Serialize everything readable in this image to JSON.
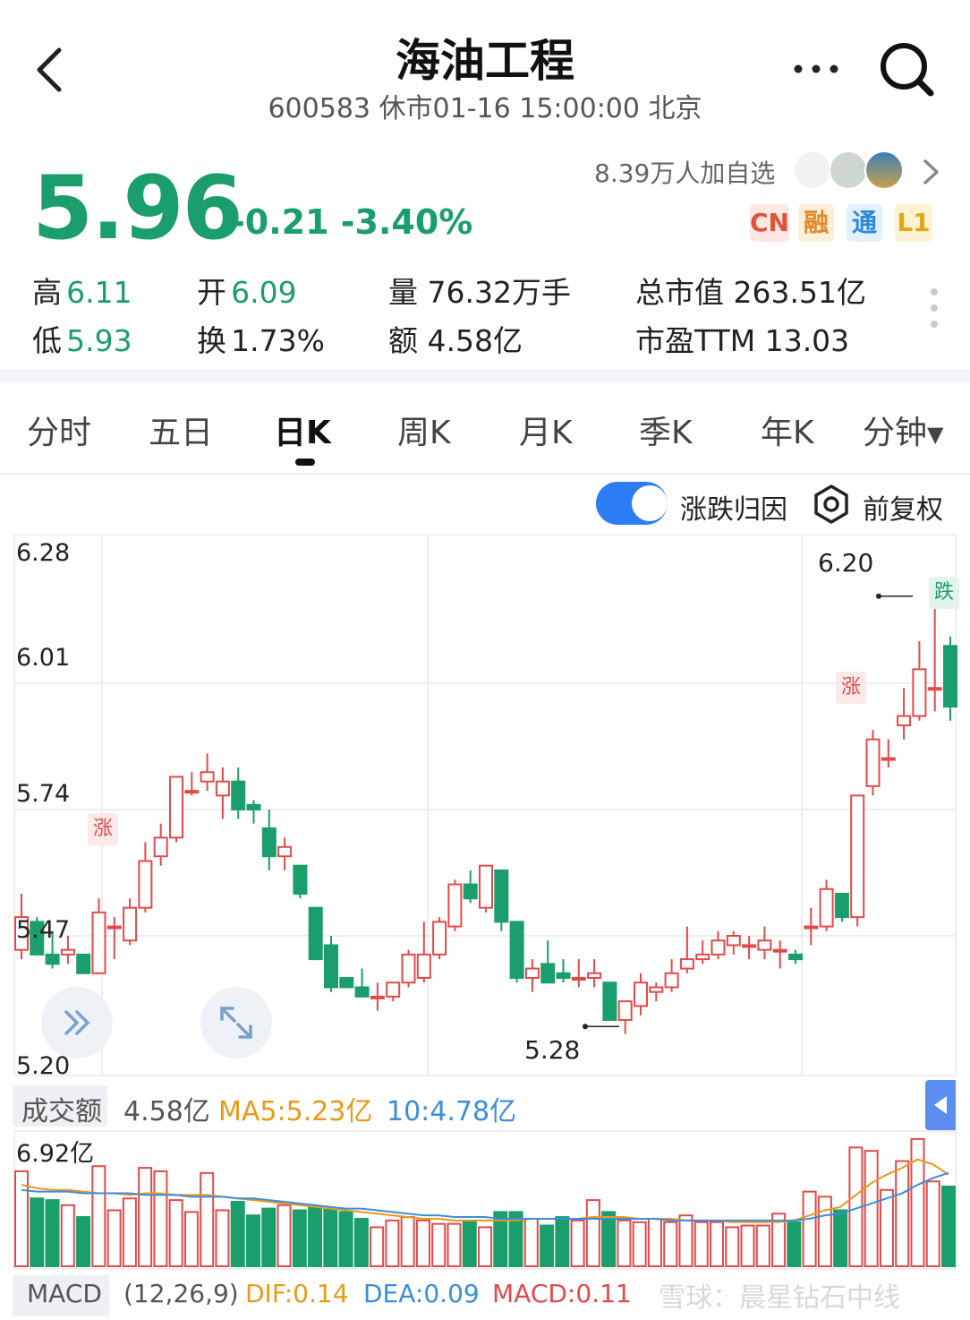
{
  "header": {
    "title": "海油工程",
    "subtitle": "600583 休市01-16 15:00:00 北京"
  },
  "quote": {
    "price": "5.96",
    "change": "-0.21 -3.40%",
    "followers": "8.39万人加自选",
    "badges": [
      "CN",
      "融",
      "通",
      "L1"
    ],
    "stats": {
      "high_label": "高",
      "high": "6.11",
      "low_label": "低",
      "low": "5.93",
      "open_label": "开",
      "open": "6.09",
      "turnover_label": "换",
      "turnover": "1.73%",
      "volume": "量 76.32万手",
      "amount": "额 4.58亿",
      "market_cap": "总市值 263.51亿",
      "pe": "市盈TTM 13.03"
    }
  },
  "tabs": [
    "分时",
    "五日",
    "日K",
    "周K",
    "月K",
    "季K",
    "年K",
    "分钟"
  ],
  "active_tab": "日K",
  "controls": {
    "toggle_label": "涨跌归因",
    "adjust_label": "前复权"
  },
  "chart_data": {
    "type": "candlestick",
    "y_ticks": [
      "6.28",
      "6.01",
      "5.74",
      "5.47",
      "5.20"
    ],
    "ylim": [
      5.2,
      6.28
    ],
    "annotations": {
      "max": "6.20",
      "min": "5.28",
      "rise_tag": "涨",
      "fall_tag": "跌"
    },
    "candles": [
      {
        "o": 5.44,
        "h": 5.56,
        "l": 5.42,
        "c": 5.51
      },
      {
        "o": 5.5,
        "h": 5.51,
        "l": 5.43,
        "c": 5.43
      },
      {
        "o": 5.43,
        "h": 5.48,
        "l": 5.4,
        "c": 5.41
      },
      {
        "o": 5.43,
        "h": 5.47,
        "l": 5.41,
        "c": 5.44
      },
      {
        "o": 5.43,
        "h": 5.43,
        "l": 5.39,
        "c": 5.39
      },
      {
        "o": 5.39,
        "h": 5.55,
        "l": 5.39,
        "c": 5.52
      },
      {
        "o": 5.49,
        "h": 5.51,
        "l": 5.42,
        "c": 5.49
      },
      {
        "o": 5.46,
        "h": 5.55,
        "l": 5.45,
        "c": 5.53
      },
      {
        "o": 5.53,
        "h": 5.67,
        "l": 5.52,
        "c": 5.63
      },
      {
        "o": 5.64,
        "h": 5.71,
        "l": 5.62,
        "c": 5.68
      },
      {
        "o": 5.68,
        "h": 5.81,
        "l": 5.67,
        "c": 5.81
      },
      {
        "o": 5.78,
        "h": 5.82,
        "l": 5.77,
        "c": 5.78
      },
      {
        "o": 5.8,
        "h": 5.86,
        "l": 5.78,
        "c": 5.82
      },
      {
        "o": 5.77,
        "h": 5.83,
        "l": 5.72,
        "c": 5.8
      },
      {
        "o": 5.8,
        "h": 5.83,
        "l": 5.72,
        "c": 5.74
      },
      {
        "o": 5.75,
        "h": 5.76,
        "l": 5.71,
        "c": 5.74
      },
      {
        "o": 5.7,
        "h": 5.74,
        "l": 5.61,
        "c": 5.64
      },
      {
        "o": 5.64,
        "h": 5.68,
        "l": 5.61,
        "c": 5.66
      },
      {
        "o": 5.62,
        "h": 5.62,
        "l": 5.55,
        "c": 5.56
      },
      {
        "o": 5.53,
        "h": 5.53,
        "l": 5.42,
        "c": 5.42
      },
      {
        "o": 5.45,
        "h": 5.47,
        "l": 5.35,
        "c": 5.36
      },
      {
        "o": 5.38,
        "h": 5.38,
        "l": 5.36,
        "c": 5.36
      },
      {
        "o": 5.36,
        "h": 5.4,
        "l": 5.34,
        "c": 5.34
      },
      {
        "o": 5.34,
        "h": 5.37,
        "l": 5.31,
        "c": 5.34
      },
      {
        "o": 5.34,
        "h": 5.37,
        "l": 5.33,
        "c": 5.37
      },
      {
        "o": 5.37,
        "h": 5.44,
        "l": 5.36,
        "c": 5.43
      },
      {
        "o": 5.38,
        "h": 5.5,
        "l": 5.37,
        "c": 5.43
      },
      {
        "o": 5.43,
        "h": 5.51,
        "l": 5.42,
        "c": 5.5
      },
      {
        "o": 5.49,
        "h": 5.59,
        "l": 5.48,
        "c": 5.58
      },
      {
        "o": 5.58,
        "h": 5.61,
        "l": 5.54,
        "c": 5.55
      },
      {
        "o": 5.53,
        "h": 5.62,
        "l": 5.52,
        "c": 5.62
      },
      {
        "o": 5.61,
        "h": 5.61,
        "l": 5.48,
        "c": 5.5
      },
      {
        "o": 5.5,
        "h": 5.5,
        "l": 5.37,
        "c": 5.38
      },
      {
        "o": 5.38,
        "h": 5.42,
        "l": 5.35,
        "c": 5.4
      },
      {
        "o": 5.41,
        "h": 5.46,
        "l": 5.37,
        "c": 5.37
      },
      {
        "o": 5.39,
        "h": 5.42,
        "l": 5.37,
        "c": 5.38
      },
      {
        "o": 5.38,
        "h": 5.42,
        "l": 5.36,
        "c": 5.38
      },
      {
        "o": 5.38,
        "h": 5.42,
        "l": 5.36,
        "c": 5.39
      },
      {
        "o": 5.37,
        "h": 5.37,
        "l": 5.29,
        "c": 5.29
      },
      {
        "o": 5.29,
        "h": 5.33,
        "l": 5.26,
        "c": 5.33
      },
      {
        "o": 5.32,
        "h": 5.39,
        "l": 5.3,
        "c": 5.37
      },
      {
        "o": 5.35,
        "h": 5.37,
        "l": 5.33,
        "c": 5.36
      },
      {
        "o": 5.36,
        "h": 5.42,
        "l": 5.35,
        "c": 5.39
      },
      {
        "o": 5.4,
        "h": 5.49,
        "l": 5.39,
        "c": 5.42
      },
      {
        "o": 5.42,
        "h": 5.46,
        "l": 5.41,
        "c": 5.43
      },
      {
        "o": 5.43,
        "h": 5.48,
        "l": 5.42,
        "c": 5.46
      },
      {
        "o": 5.45,
        "h": 5.48,
        "l": 5.43,
        "c": 5.47
      },
      {
        "o": 5.45,
        "h": 5.47,
        "l": 5.42,
        "c": 5.45
      },
      {
        "o": 5.44,
        "h": 5.49,
        "l": 5.42,
        "c": 5.46
      },
      {
        "o": 5.44,
        "h": 5.46,
        "l": 5.4,
        "c": 5.44
      },
      {
        "o": 5.43,
        "h": 5.44,
        "l": 5.41,
        "c": 5.42
      },
      {
        "o": 5.49,
        "h": 5.53,
        "l": 5.45,
        "c": 5.49
      },
      {
        "o": 5.49,
        "h": 5.59,
        "l": 5.48,
        "c": 5.57
      },
      {
        "o": 5.56,
        "h": 5.56,
        "l": 5.5,
        "c": 5.51
      },
      {
        "o": 5.51,
        "h": 5.77,
        "l": 5.49,
        "c": 5.77
      },
      {
        "o": 5.79,
        "h": 5.91,
        "l": 5.77,
        "c": 5.89
      },
      {
        "o": 5.85,
        "h": 5.89,
        "l": 5.83,
        "c": 5.85
      },
      {
        "o": 5.92,
        "h": 6.0,
        "l": 5.89,
        "c": 5.94
      },
      {
        "o": 5.94,
        "h": 6.1,
        "l": 5.93,
        "c": 6.04
      },
      {
        "o": 6.0,
        "h": 6.17,
        "l": 5.95,
        "c": 6.0
      },
      {
        "o": 6.09,
        "h": 6.11,
        "l": 5.93,
        "c": 5.96
      }
    ]
  },
  "volume": {
    "label": "成交额",
    "value": "4.58亿",
    "ma5": "MA5:5.23亿",
    "ma10": "10:4.78亿",
    "max_label": "6.92亿",
    "values": [
      5.6,
      4.0,
      3.9,
      3.6,
      2.9,
      5.9,
      3.3,
      4.0,
      5.8,
      5.6,
      3.9,
      3.2,
      5.5,
      3.3,
      3.8,
      3.0,
      3.4,
      3.6,
      3.3,
      3.5,
      3.4,
      3.2,
      2.8,
      2.3,
      2.7,
      2.9,
      2.7,
      2.5,
      2.5,
      2.6,
      2.3,
      3.2,
      3.2,
      2.8,
      2.4,
      2.9,
      2.7,
      3.9,
      3.2,
      2.7,
      2.6,
      2.8,
      2.6,
      3.0,
      2.6,
      2.6,
      2.3,
      2.4,
      2.4,
      3.1,
      2.6,
      4.4,
      4.1,
      3.3,
      7.0,
      6.8,
      4.5,
      6.2,
      7.5,
      5.0,
      4.7
    ],
    "ma5_line": [
      4.8,
      4.6,
      4.5,
      4.5,
      4.4,
      4.3,
      4.3,
      4.2,
      4.3,
      4.3,
      4.2,
      4.2,
      4.2,
      4.1,
      4.0,
      3.9,
      3.8,
      3.7,
      3.6,
      3.5,
      3.4,
      3.3,
      3.2,
      3.1,
      3.0,
      2.9,
      2.8,
      2.8,
      2.7,
      2.7,
      2.7,
      2.7,
      2.7,
      2.8,
      2.8,
      2.8,
      2.8,
      2.9,
      2.9,
      2.9,
      2.8,
      2.8,
      2.8,
      2.7,
      2.7,
      2.7,
      2.6,
      2.6,
      2.6,
      2.6,
      2.7,
      3.0,
      3.3,
      3.5,
      4.2,
      4.9,
      5.4,
      5.8,
      6.3,
      6.0,
      5.4
    ],
    "ma10_line": [
      4.5,
      4.4,
      4.4,
      4.4,
      4.3,
      4.3,
      4.3,
      4.3,
      4.2,
      4.2,
      4.2,
      4.1,
      4.1,
      4.1,
      4.0,
      4.0,
      3.9,
      3.8,
      3.7,
      3.6,
      3.5,
      3.4,
      3.4,
      3.3,
      3.2,
      3.1,
      3.0,
      3.0,
      2.9,
      2.9,
      2.9,
      2.8,
      2.8,
      2.8,
      2.8,
      2.8,
      2.8,
      2.8,
      2.8,
      2.8,
      2.8,
      2.8,
      2.7,
      2.7,
      2.7,
      2.7,
      2.7,
      2.7,
      2.7,
      2.7,
      2.7,
      2.8,
      3.0,
      3.1,
      3.4,
      3.7,
      4.0,
      4.3,
      4.8,
      5.2,
      5.5
    ]
  },
  "macd": {
    "label": "MACD",
    "params": "(12,26,9)",
    "dif": "DIF:0.14",
    "dea": "DEA:0.09",
    "macd": "MACD:0.11"
  },
  "watermark": "雪球：晨星钻石中线",
  "colors": {
    "up": "#e24a4a",
    "down": "#1a9e6b",
    "accent": "#2b7cf5"
  }
}
